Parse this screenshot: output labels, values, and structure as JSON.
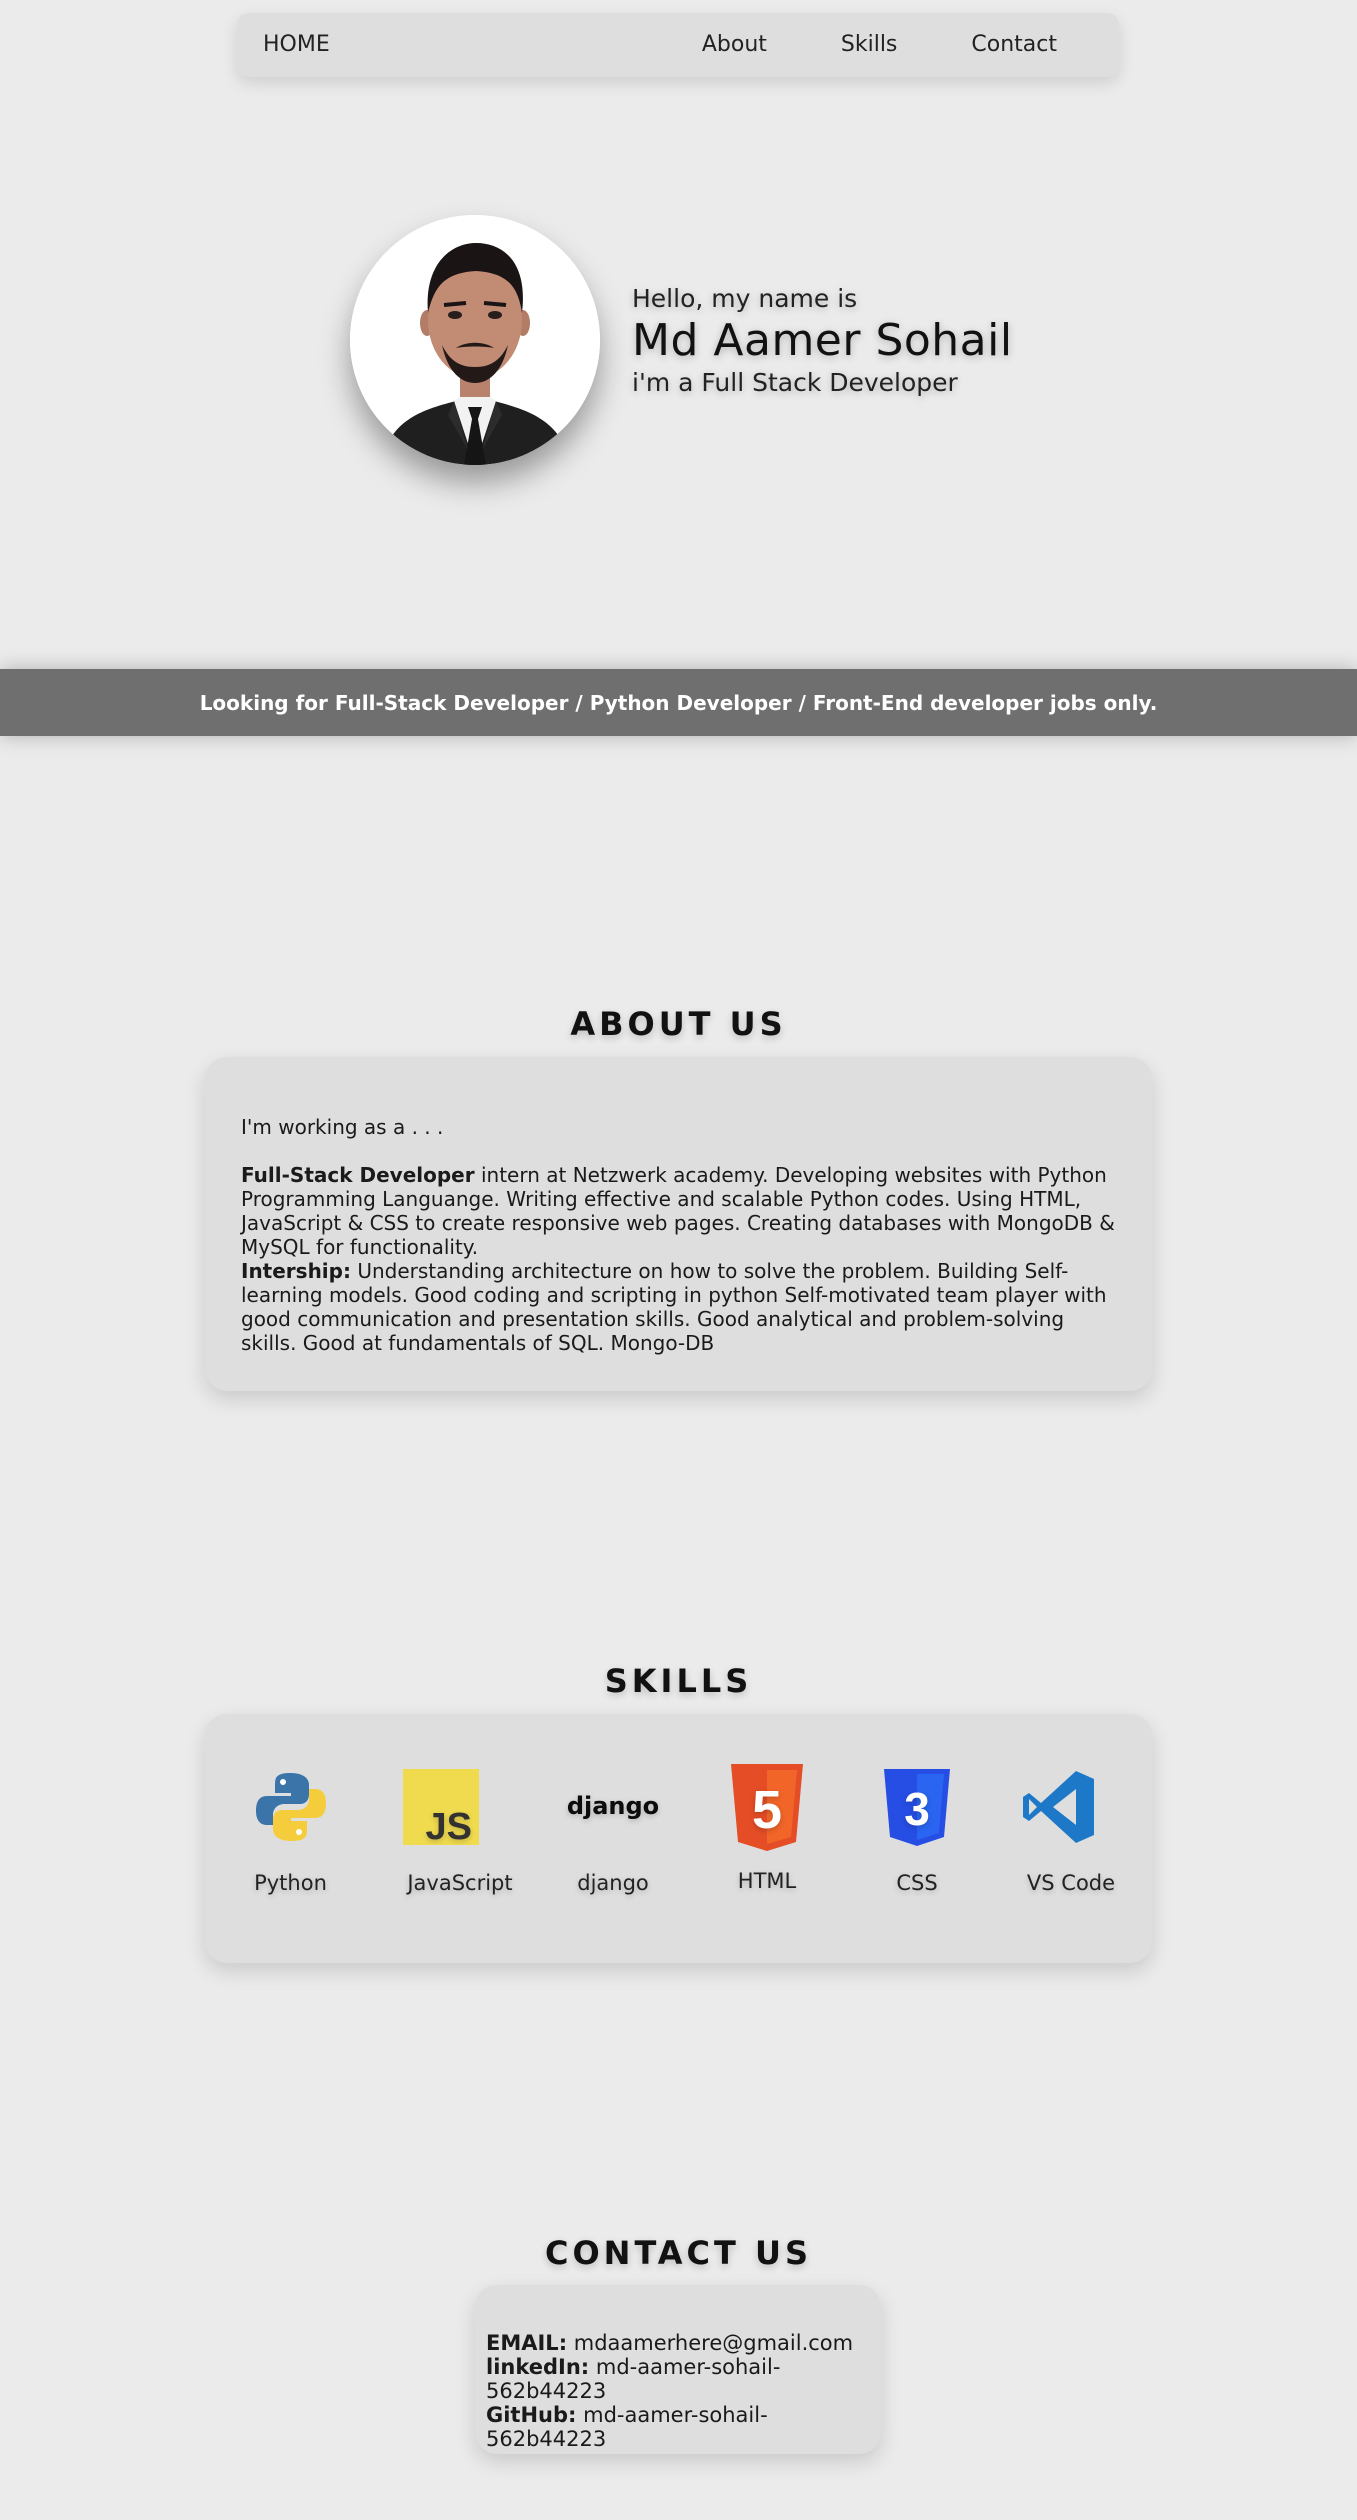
{
  "nav": {
    "home": "HOME",
    "links": [
      "About",
      "Skills",
      "Contact"
    ]
  },
  "hero": {
    "greeting": "Hello, my name is",
    "name": "Md Aamer Sohail",
    "role": "i'm a Full Stack Developer"
  },
  "banner": {
    "text": "Looking for Full-Stack Developer / Python Developer / Front-End developer jobs only."
  },
  "about": {
    "title": "ABOUT US",
    "intro": "I'm working as a . . .",
    "job_title": "Full-Stack Developer",
    "job_text": " intern at Netzwerk academy. Developing websites with Python Programming Languange. Writing effective and scalable Python codes. Using HTML, JavaScript & CSS to create responsive web pages. Creating databases with MongoDB & MySQL for functionality.",
    "intern_title": "Intership:",
    "intern_text": " Understanding architecture on how to solve the problem. Building Self-learning models. Good coding and scripting in python Self-motivated team player with good communication and presentation skills. Good analytical and problem-solving skills. Good at fundamentals of SQL. Mongo-DB"
  },
  "skills": {
    "title": "SKILLS",
    "items": [
      {
        "label": "Python",
        "icon": "python-logo-icon"
      },
      {
        "label": "JavaScript",
        "icon": "javascript-logo-icon"
      },
      {
        "label": "django",
        "icon": "django-logo-icon",
        "logo_text": "django"
      },
      {
        "label": "HTML",
        "icon": "html5-logo-icon",
        "logo_text": "5"
      },
      {
        "label": "CSS",
        "icon": "css3-logo-icon",
        "logo_text": "3"
      },
      {
        "label": "VS Code",
        "icon": "vscode-logo-icon"
      }
    ],
    "js_logo_text": "JS"
  },
  "contact": {
    "title": "CONTACT US",
    "email_label": "EMAIL:",
    "email": " mdaamerhere@gmail.com",
    "linkedin_label": "linkedIn:",
    "linkedin": " md-aamer-sohail-562b44223",
    "github_label": "GitHub:",
    "github": " md-aamer-sohail-562b44223"
  },
  "colors": {
    "background": "#ebebeb",
    "card": "#dedede",
    "banner": "#6f6f6f",
    "python_blue": "#3b74a8",
    "python_yellow": "#f5cd3c",
    "js_yellow": "#f0db4f",
    "html_orange": "#e44d26",
    "css_blue": "#264de4",
    "vscode_blue": "#1e78c8"
  }
}
